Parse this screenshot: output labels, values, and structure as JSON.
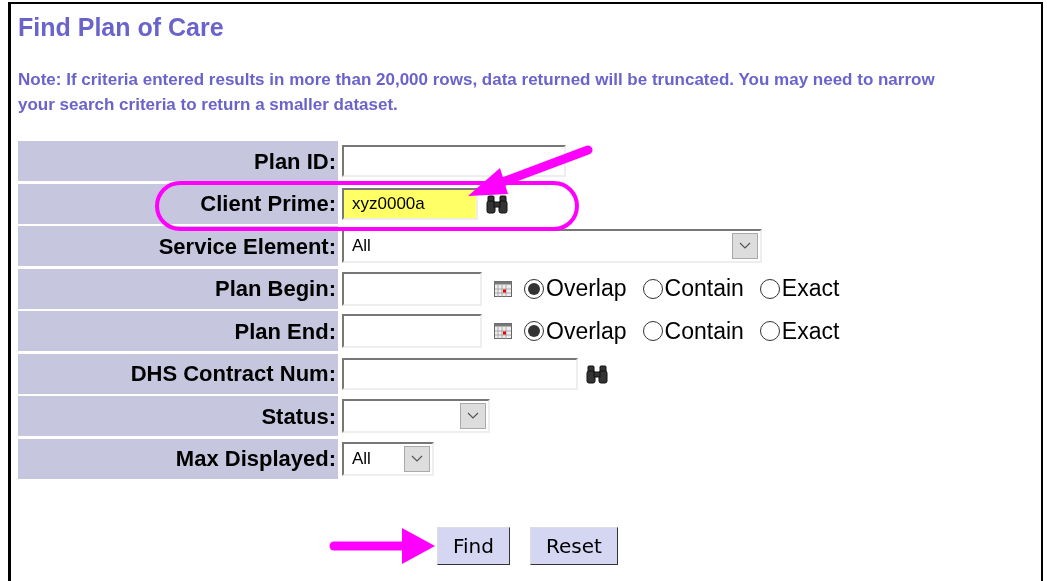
{
  "title": "Find Plan of Care",
  "note": "Note: If criteria entered results in more than 20,000 rows, data returned will be truncated. You may need to narrow your search criteria to return a smaller dataset.",
  "rows": [
    {
      "label": "Plan ID:",
      "kind": "text"
    },
    {
      "label": "Client Prime:",
      "kind": "text",
      "value": "xyz0000a",
      "highlighted": true,
      "lookup": true
    },
    {
      "label": "Service Element:",
      "kind": "select",
      "value": "All"
    },
    {
      "label": "Plan Begin:",
      "kind": "date",
      "options": [
        {
          "label": "Overlap",
          "selected": true
        },
        {
          "label": "Contain",
          "selected": false
        },
        {
          "label": "Exact",
          "selected": false
        }
      ]
    },
    {
      "label": "Plan End:",
      "kind": "date",
      "options": [
        {
          "label": "Overlap",
          "selected": true
        },
        {
          "label": "Contain",
          "selected": false
        },
        {
          "label": "Exact",
          "selected": false
        }
      ]
    },
    {
      "label": "DHS Contract Num:",
      "kind": "text",
      "lookup": true
    },
    {
      "label": "Status:",
      "kind": "select"
    },
    {
      "label": "Max Displayed:",
      "kind": "select",
      "value": "All"
    }
  ],
  "buttons": [
    "Find",
    "Reset"
  ]
}
